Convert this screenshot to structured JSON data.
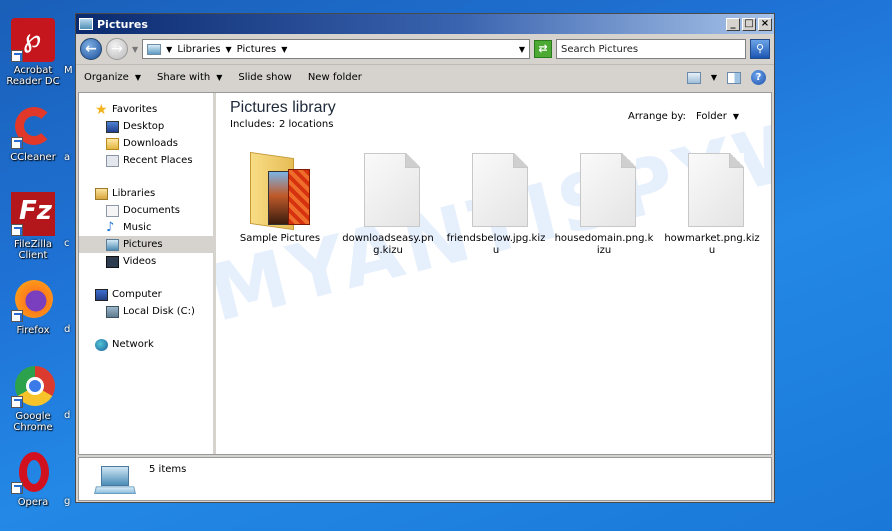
{
  "desktop": {
    "icons": [
      {
        "label": "Acrobat Reader DC",
        "icon": "acrobat-icon"
      },
      {
        "label": "CCleaner",
        "icon": "ccleaner-icon"
      },
      {
        "label": "FileZilla Client",
        "icon": "filezilla-icon"
      },
      {
        "label": "Firefox",
        "icon": "firefox-icon"
      },
      {
        "label": "Google Chrome",
        "icon": "chrome-icon"
      },
      {
        "label": "Opera",
        "icon": "opera-icon"
      }
    ],
    "second_column_fragments": [
      "M",
      "a",
      "c",
      "d",
      "d",
      "g"
    ]
  },
  "window": {
    "title": "Pictures",
    "controls": {
      "minimize": "_",
      "maximize": "□",
      "close": "×"
    },
    "address": {
      "breadcrumb": [
        "Libraries",
        "Pictures"
      ],
      "separator": "▸"
    },
    "search": {
      "placeholder": "Search Pictures"
    },
    "toolbar": {
      "organize": "Organize",
      "share_with": "Share with",
      "slide_show": "Slide show",
      "new_folder": "New folder"
    },
    "nav": {
      "favorites": "Favorites",
      "desktop": "Desktop",
      "downloads": "Downloads",
      "recent_places": "Recent Places",
      "libraries": "Libraries",
      "documents": "Documents",
      "music": "Music",
      "pictures": "Pictures",
      "videos": "Videos",
      "computer": "Computer",
      "local_disk": "Local Disk (C:)",
      "network": "Network"
    },
    "content": {
      "title": "Pictures library",
      "includes_label": "Includes:",
      "includes_value": "2 locations",
      "arrange_label": "Arrange by:",
      "arrange_value": "Folder",
      "files": [
        {
          "name": "Sample Pictures",
          "type": "folder"
        },
        {
          "name": "downloadseasy.png.kizu",
          "type": "file"
        },
        {
          "name": "friendsbelow.jpg.kizu",
          "type": "file"
        },
        {
          "name": "housedomain.png.kizu",
          "type": "file"
        },
        {
          "name": "howmarket.png.kizu",
          "type": "file"
        }
      ]
    },
    "status": {
      "items_count": "5 items"
    }
  },
  "watermark": "MYANTISPYWARE.COM"
}
